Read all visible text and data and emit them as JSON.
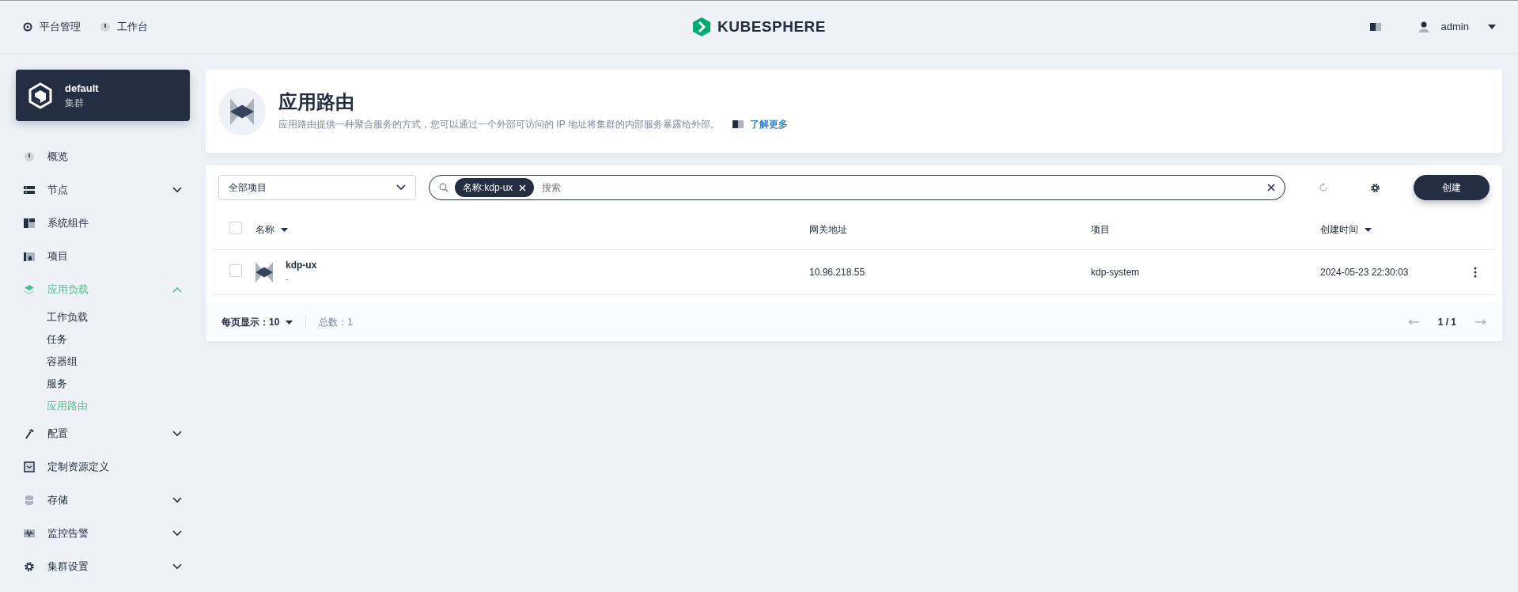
{
  "topbar": {
    "nav": [
      {
        "label": "平台管理"
      },
      {
        "label": "工作台"
      }
    ],
    "logo": "KUBESPHERE",
    "user": "admin"
  },
  "cluster": {
    "name": "default",
    "type": "集群"
  },
  "sidebar": {
    "items": [
      {
        "label": "概览",
        "selected": false
      },
      {
        "label": "节点",
        "selected": false,
        "expanded": false
      },
      {
        "label": "系统组件",
        "selected": false
      },
      {
        "label": "项目",
        "selected": false
      },
      {
        "label": "应用负载",
        "selected": true,
        "expanded": true,
        "children": [
          {
            "label": "工作负载",
            "selected": false
          },
          {
            "label": "任务",
            "selected": false
          },
          {
            "label": "容器组",
            "selected": false
          },
          {
            "label": "服务",
            "selected": false
          },
          {
            "label": "应用路由",
            "selected": true
          }
        ]
      },
      {
        "label": "配置",
        "selected": false,
        "expanded": false
      },
      {
        "label": "定制资源定义",
        "selected": false
      },
      {
        "label": "存储",
        "selected": false,
        "expanded": false
      },
      {
        "label": "监控告警",
        "selected": false,
        "expanded": false
      },
      {
        "label": "集群设置",
        "selected": false,
        "expanded": false
      }
    ]
  },
  "header": {
    "title": "应用路由",
    "description": "应用路由提供一种聚合服务的方式，您可以通过一个外部可访问的 IP 地址将集群的内部服务暴露给外部。",
    "link": "了解更多"
  },
  "toolbar": {
    "project_select": "全部项目",
    "filter_tag": "名称:kdp-ux",
    "search_placeholder": "搜索",
    "create_button": "创建"
  },
  "table": {
    "select_all": {
      "checked": false
    },
    "columns": [
      {
        "label": "名称",
        "sortable": true
      },
      {
        "label": "网关地址",
        "sortable": false
      },
      {
        "label": "项目",
        "sortable": false
      },
      {
        "label": "创建时间",
        "sortable": true
      }
    ],
    "rows": [
      {
        "checked": false,
        "name": "kdp-ux",
        "description": "-",
        "gateway": "10.96.218.55",
        "project": "kdp-system",
        "created": "2024-05-23 22:30:03"
      }
    ]
  },
  "pagination": {
    "page_size": "每页显示：10",
    "total": "总数：1",
    "page": "1 / 1"
  }
}
